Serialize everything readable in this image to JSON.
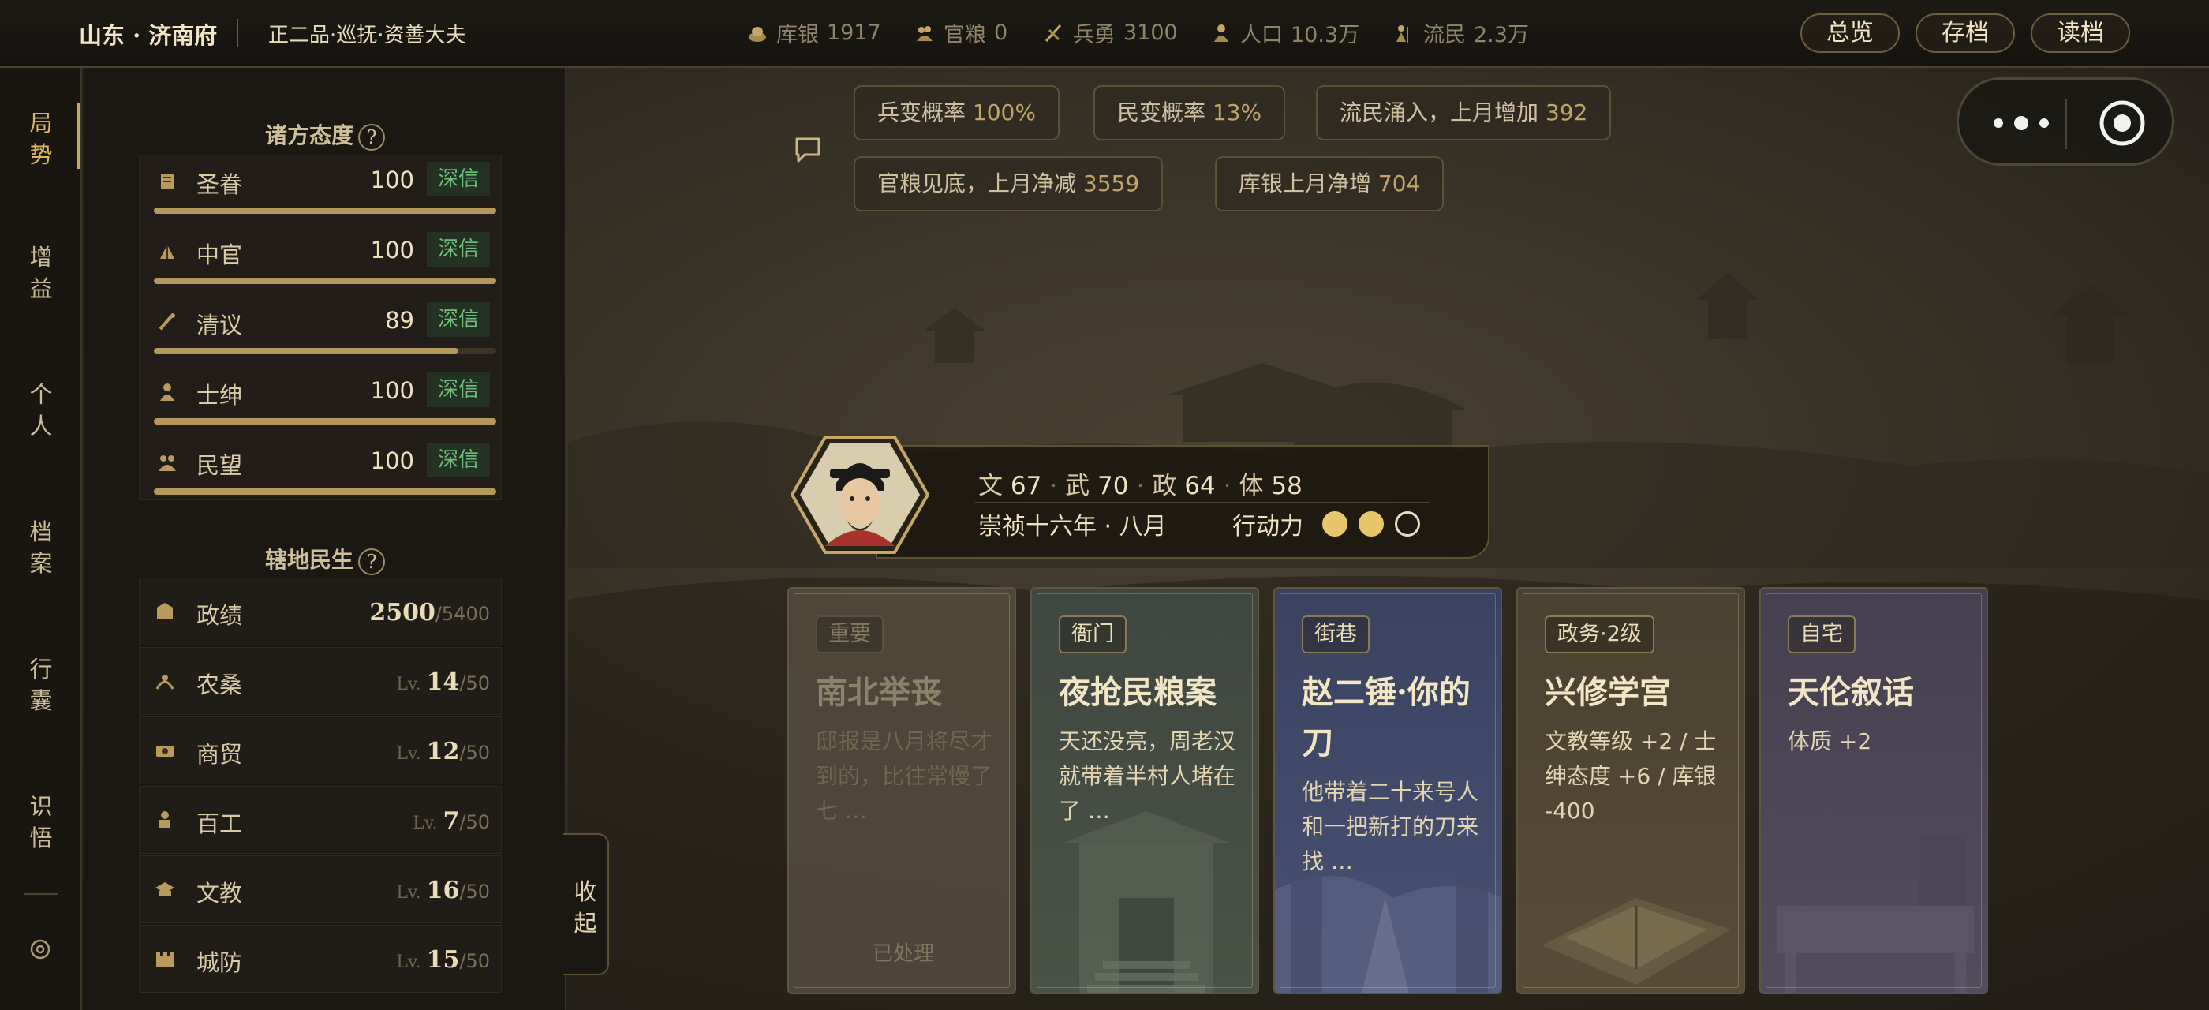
{
  "topbar": {
    "location": "山东 · 济南府",
    "rank": "正二品·巡抚·资善大夫",
    "resources": [
      {
        "name": "库银",
        "value": "1917",
        "icon": "silver-icon"
      },
      {
        "name": "官粮",
        "value": "0",
        "icon": "grain-icon"
      },
      {
        "name": "兵勇",
        "value": "3100",
        "icon": "soldier-icon"
      },
      {
        "name": "人口",
        "value": "10.3万",
        "icon": "population-icon"
      },
      {
        "name": "流民",
        "value": "2.3万",
        "icon": "refugee-icon"
      }
    ],
    "buttons": {
      "overview": "总览",
      "save": "存档",
      "load": "读档"
    }
  },
  "nav": {
    "items": [
      {
        "label": "局\n势",
        "active": true
      },
      {
        "label": "增\n益"
      },
      {
        "label": "个\n人"
      },
      {
        "label": "档\n案"
      },
      {
        "label": "行\n囊"
      },
      {
        "label": "识\n悟"
      }
    ],
    "settings_icon": "target-icon"
  },
  "attitudes": {
    "title": "诸方态度",
    "help": "?",
    "rows": [
      {
        "name": "圣眷",
        "value": "100",
        "badge": "深信",
        "fill": 1.0,
        "icon": "scroll-icon"
      },
      {
        "name": "中官",
        "value": "100",
        "badge": "深信",
        "fill": 1.0,
        "icon": "fan-icon"
      },
      {
        "name": "清议",
        "value": "89",
        "badge": "深信",
        "fill": 0.89,
        "icon": "brush-icon"
      },
      {
        "name": "士绅",
        "value": "100",
        "badge": "深信",
        "fill": 1.0,
        "icon": "gentry-icon"
      },
      {
        "name": "民望",
        "value": "100",
        "badge": "深信",
        "fill": 1.0,
        "icon": "people-icon"
      }
    ]
  },
  "livelihood": {
    "title": "辖地民生",
    "help": "?",
    "rows": [
      {
        "name": "政绩",
        "prefix": "",
        "value": "2500",
        "cap": "/5400",
        "icon": "merit-icon"
      },
      {
        "name": "农桑",
        "prefix": "Lv.",
        "value": "14",
        "cap": "/50",
        "icon": "farm-icon"
      },
      {
        "name": "商贸",
        "prefix": "Lv.",
        "value": "12",
        "cap": "/50",
        "icon": "trade-icon"
      },
      {
        "name": "百工",
        "prefix": "Lv.",
        "value": "7",
        "cap": "/50",
        "icon": "craft-icon"
      },
      {
        "name": "文教",
        "prefix": "Lv.",
        "value": "16",
        "cap": "/50",
        "icon": "education-icon"
      },
      {
        "name": "城防",
        "prefix": "Lv.",
        "value": "15",
        "cap": "/50",
        "icon": "fortress-icon"
      }
    ]
  },
  "collapse_label": "收\n起",
  "alerts": [
    {
      "text": "兵变概率",
      "value": "100%"
    },
    {
      "text": "民变概率",
      "value": "13%"
    },
    {
      "text": "流民涌入，上月增加",
      "value": "392"
    },
    {
      "text": "官粮见底，上月净减",
      "value": "3559"
    },
    {
      "text": "库银上月净增",
      "value": "704"
    }
  ],
  "character": {
    "stats": [
      {
        "label": "文",
        "value": "67"
      },
      {
        "label": "武",
        "value": "70"
      },
      {
        "label": "政",
        "value": "64"
      },
      {
        "label": "体",
        "value": "58"
      }
    ],
    "date": "崇祯十六年 · 八月",
    "action_label": "行动力",
    "action_points": {
      "current": 2,
      "max": 3
    }
  },
  "cards": [
    {
      "tag": "重要",
      "title": "南北举丧",
      "desc": "邸报是八月将尽才到的，比往常慢了七 …",
      "status": "已处理",
      "theme": "done"
    },
    {
      "tag": "衙门",
      "title": "夜抢民粮案",
      "desc": "天还没亮，周老汉就带着半村人堵在了 …",
      "theme": "green"
    },
    {
      "tag": "街巷",
      "title": "赵二锤·你的刀",
      "desc": "他带着二十来号人和一把新打的刀来找 …",
      "theme": "blue"
    },
    {
      "tag": "政务·2级",
      "title": "兴修学宫",
      "desc": "文教等级 +2 / 士绅态度 +6 / 库银 -400",
      "theme": "gold"
    },
    {
      "tag": "自宅",
      "title": "天伦叙话",
      "desc": "体质 +2",
      "theme": "purple"
    }
  ],
  "colors": {
    "accent": "#c5a86a",
    "badge_green": "#6fbf7a",
    "action_point": "#e8c66c"
  }
}
